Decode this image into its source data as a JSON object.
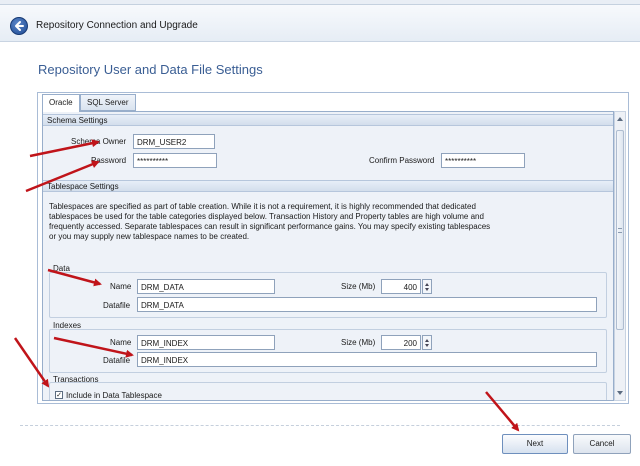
{
  "window": {
    "title": "Repository Connection and Upgrade"
  },
  "section_title": "Repository User and Data File Settings",
  "tabs": [
    {
      "label": "Oracle",
      "selected": true
    },
    {
      "label": "SQL Server",
      "selected": false
    }
  ],
  "schema": {
    "header": "Schema Settings",
    "owner_label": "Schema Owner",
    "owner_value": "DRM_USER2",
    "password_label": "Password",
    "password_value": "**********",
    "confirm_label": "Confirm Password",
    "confirm_value": "**********"
  },
  "tablespace": {
    "header": "Tablespace Settings",
    "description": [
      "Tablespaces are specified as part of table creation. While it is not a requirement, it is highly recommended that dedicated",
      "tablespaces be used for the table categories displayed below. Transaction History and Property tables are high volume and",
      "frequently accessed.  Separate tablespaces can result in significant performance gains. You may specify existing tablespaces",
      "or you may supply new tablespace names to be created."
    ]
  },
  "data": {
    "group_label": "Data",
    "name_label": "Name",
    "name_value": "DRM_DATA",
    "size_label": "Size (Mb)",
    "size_value": "400",
    "datafile_label": "Datafile",
    "datafile_value": "DRM_DATA"
  },
  "indexes": {
    "group_label": "Indexes",
    "name_label": "Name",
    "name_value": "DRM_INDEX",
    "size_label": "Size (Mb)",
    "size_value": "200",
    "datafile_label": "Datafile",
    "datafile_value": "DRM_INDEX"
  },
  "transactions": {
    "group_label": "Transactions",
    "include_label": "Include in Data Tablespace",
    "include_checked": true,
    "check_mark": "✓"
  },
  "buttons": {
    "next": "Next",
    "cancel": "Cancel"
  },
  "colors": {
    "accent": "#3a5e94",
    "annotation_arrow": "#c0141a"
  },
  "icons": {
    "back": "back-arrow-icon",
    "spin_up": "spin-up-icon",
    "spin_down": "spin-down-icon"
  }
}
